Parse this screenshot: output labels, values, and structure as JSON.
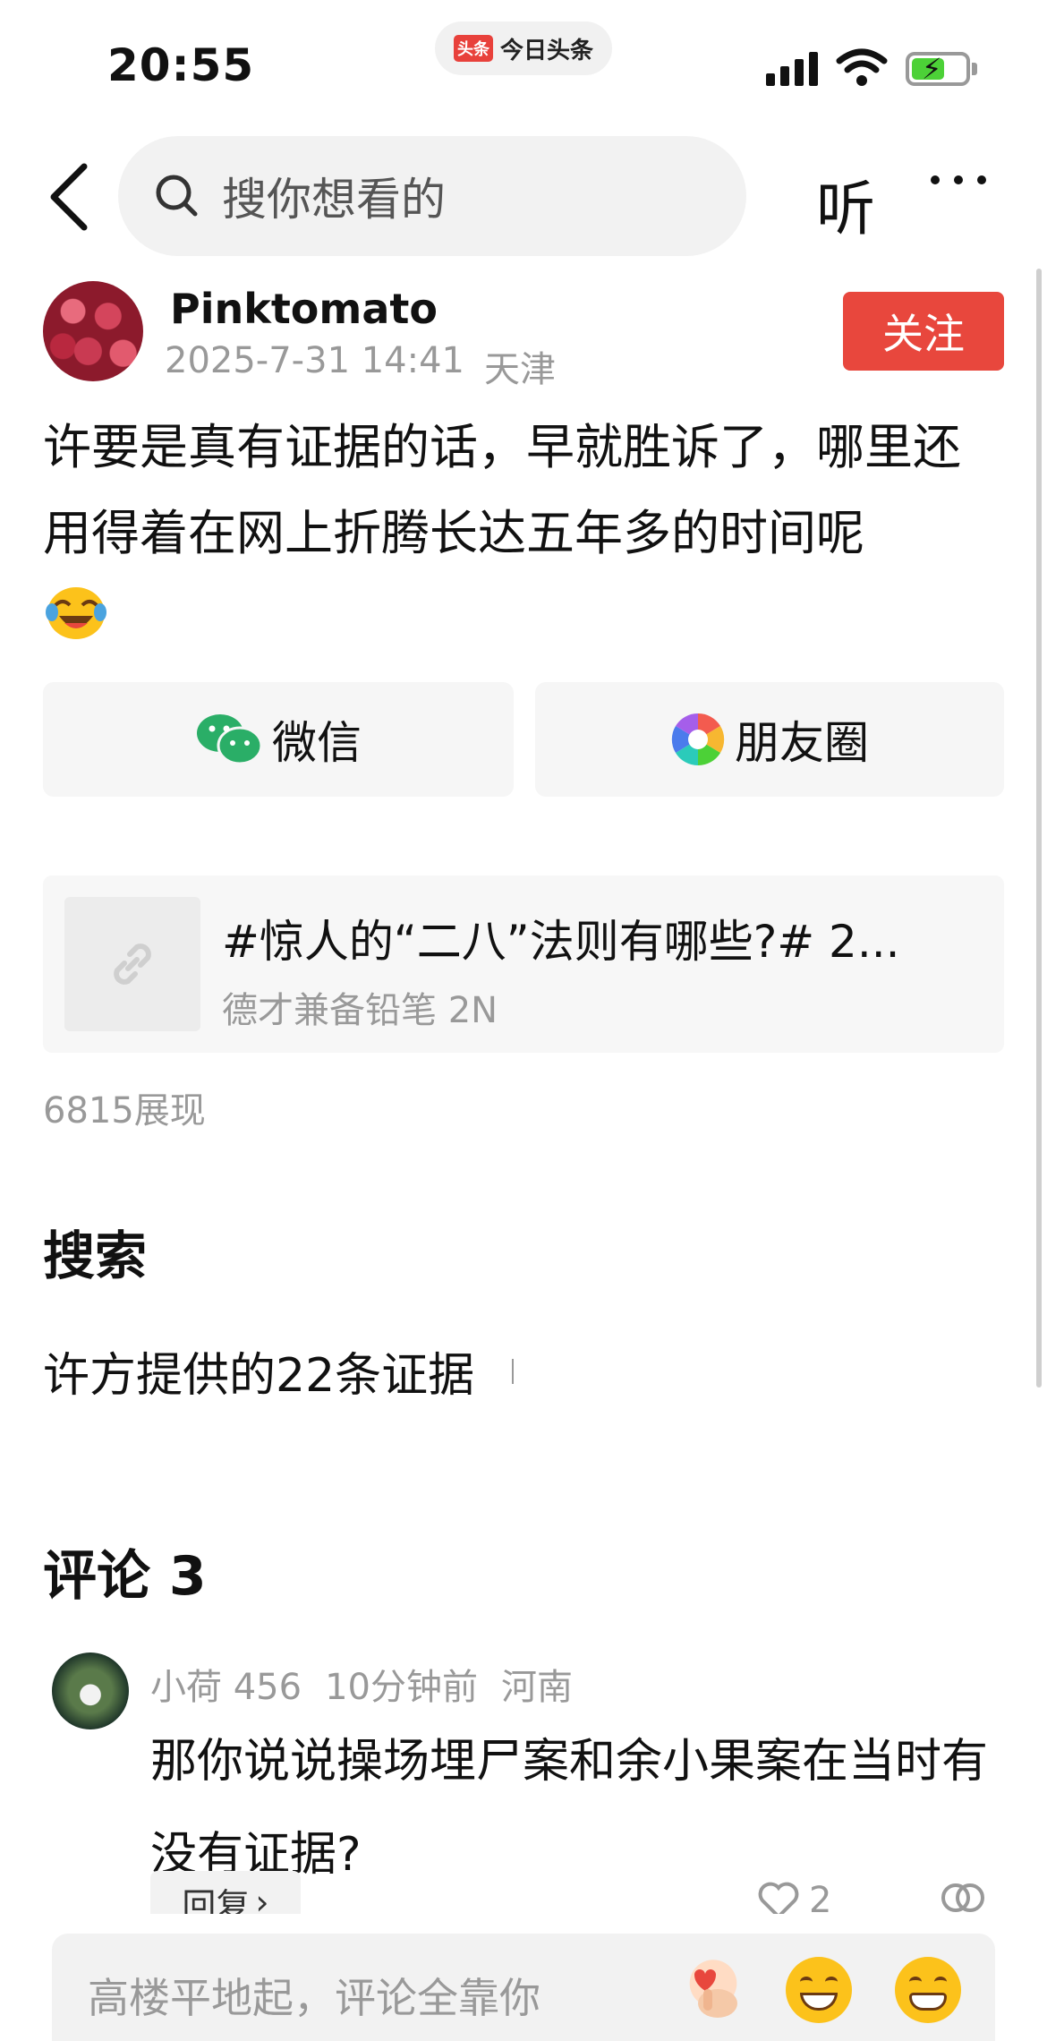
{
  "status_bar": {
    "time": "20:55",
    "app_badge": "今日头条",
    "app_logo": "头条",
    "battery_state": "charging",
    "accent_green": "#4cd137"
  },
  "nav": {
    "search_placeholder": "搜你想看的",
    "listen_label": "听",
    "icons": [
      "back-arrow-icon",
      "search-icon",
      "more-dots-icon"
    ]
  },
  "post": {
    "author": "Pinktomato",
    "date": "2025-7-31 14:41",
    "location": "天津",
    "follow_label": "关注",
    "follow_color": "#e8473d",
    "text": "许要是真有证据的话，早就胜诉了，哪里还用得着在网上折腾长达五年多的时间呢",
    "emoji": "rolling-laughing-emoji"
  },
  "share": {
    "wechat": "微信",
    "moments": "朋友圈"
  },
  "link_card": {
    "title": "#惊人的“二八”法则有哪些?# 2...",
    "subtitle": "德才兼备铅笔 2N",
    "icon": "link-icon"
  },
  "views": "6815展现",
  "search_section": {
    "title": "搜索",
    "suggestion": "许方提供的22条证据"
  },
  "comments": {
    "title": "评论 3",
    "items": [
      {
        "user": "小荷 456",
        "time": "10分钟前",
        "location": "河南",
        "text": "那你说说操场埋尸案和余小果案在当时有没有证据?",
        "reply_label": "回复",
        "likes": "2"
      }
    ]
  },
  "bottom_bar": {
    "placeholder": "高楼平地起，评论全靠你",
    "emojis": [
      "finger-heart-emoji",
      "laughing-emoji",
      "grinning-emoji"
    ]
  }
}
